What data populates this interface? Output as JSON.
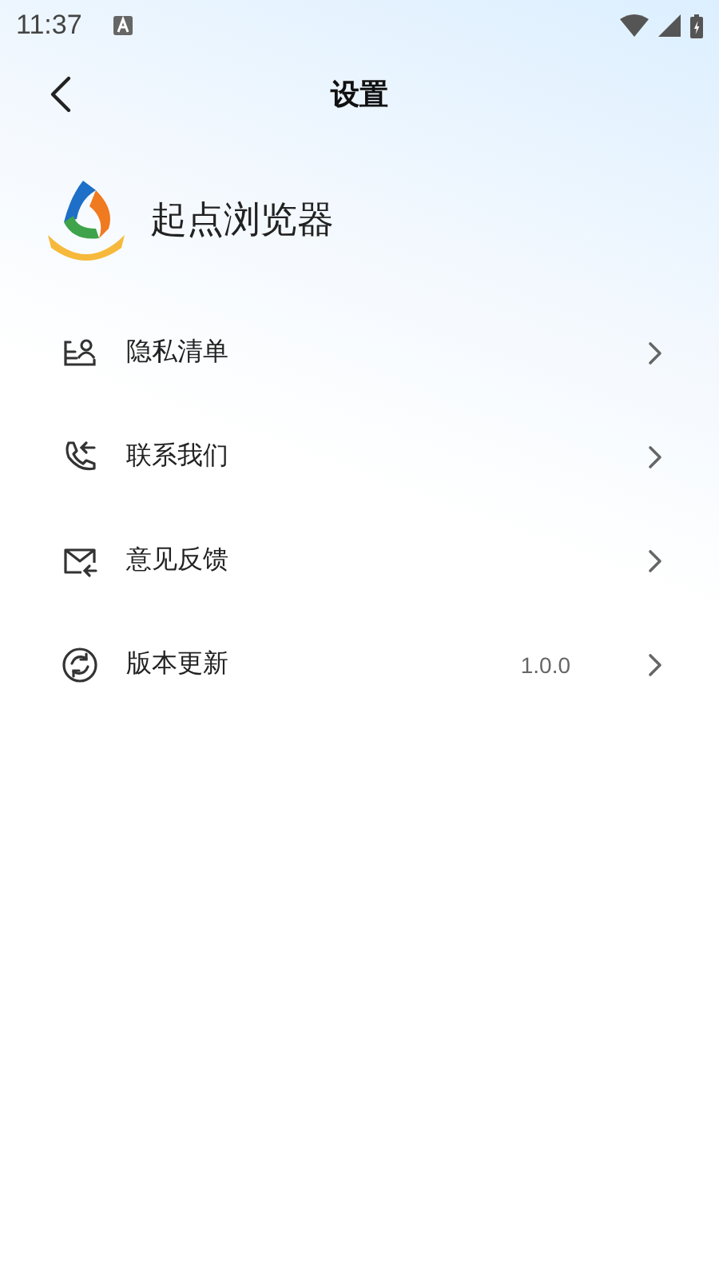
{
  "status_bar": {
    "time": "11:37"
  },
  "header": {
    "title": "设置"
  },
  "app": {
    "name": "起点浏览器"
  },
  "items": [
    {
      "kind": "privacy",
      "label": "隐私清单"
    },
    {
      "kind": "contact",
      "label": "联系我们"
    },
    {
      "kind": "feedback",
      "label": "意见反馈"
    },
    {
      "kind": "update",
      "label": "版本更新",
      "value": "1.0.0"
    }
  ]
}
